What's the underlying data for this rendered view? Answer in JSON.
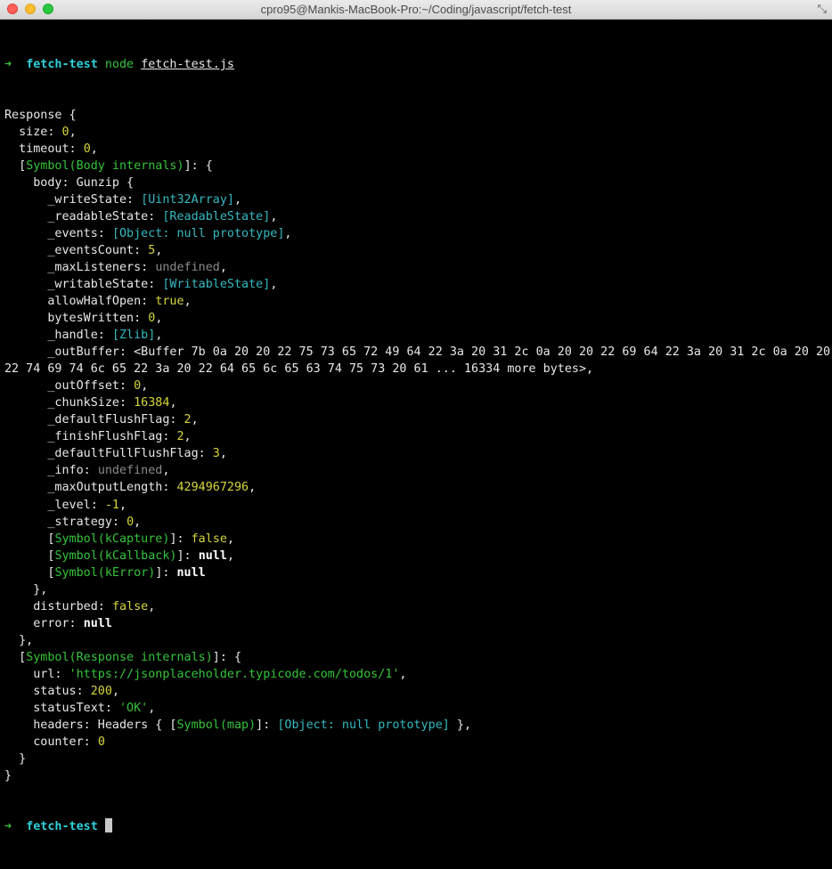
{
  "window": {
    "title": "cpro95@Mankis-MacBook-Pro:~/Coding/javascript/fetch-test",
    "fullscreen_glyph": "⤡"
  },
  "prompt": {
    "arrow": "➜",
    "dir": "fetch-test",
    "command": "node",
    "argument": "fetch-test.js"
  },
  "lines": [
    [
      {
        "t": "Response {"
      }
    ],
    [
      {
        "t": "  size: "
      },
      {
        "t": "0",
        "c": "num"
      },
      {
        "t": ","
      }
    ],
    [
      {
        "t": "  timeout: "
      },
      {
        "t": "0",
        "c": "num"
      },
      {
        "t": ","
      }
    ],
    [
      {
        "t": "  ["
      },
      {
        "t": "Symbol(Body internals)",
        "c": "sym"
      },
      {
        "t": "]: {"
      }
    ],
    [
      {
        "t": "    body: Gunzip {"
      }
    ],
    [
      {
        "t": "      _writeState: "
      },
      {
        "t": "[Uint32Array]",
        "c": "obj"
      },
      {
        "t": ","
      }
    ],
    [
      {
        "t": "      _readableState: "
      },
      {
        "t": "[ReadableState]",
        "c": "obj"
      },
      {
        "t": ","
      }
    ],
    [
      {
        "t": "      _events: "
      },
      {
        "t": "[Object: null prototype]",
        "c": "obj"
      },
      {
        "t": ","
      }
    ],
    [
      {
        "t": "      _eventsCount: "
      },
      {
        "t": "5",
        "c": "num"
      },
      {
        "t": ","
      }
    ],
    [
      {
        "t": "      _maxListeners: "
      },
      {
        "t": "undefined",
        "c": "undef"
      },
      {
        "t": ","
      }
    ],
    [
      {
        "t": "      _writableState: "
      },
      {
        "t": "[WritableState]",
        "c": "obj"
      },
      {
        "t": ","
      }
    ],
    [
      {
        "t": "      allowHalfOpen: "
      },
      {
        "t": "true",
        "c": "num"
      },
      {
        "t": ","
      }
    ],
    [
      {
        "t": "      bytesWritten: "
      },
      {
        "t": "0",
        "c": "num"
      },
      {
        "t": ","
      }
    ],
    [
      {
        "t": "      _handle: "
      },
      {
        "t": "[Zlib]",
        "c": "obj"
      },
      {
        "t": ","
      }
    ],
    [
      {
        "t": "      _outBuffer: <Buffer 7b 0a 20 20 22 75 73 65 72 49 64 22 3a 20 31 2c 0a 20 20 22 69 64 22 3a 20 31 2c 0a 20 20"
      }
    ],
    [
      {
        "t": "22 74 69 74 6c 65 22 3a 20 22 64 65 6c 65 63 74 75 73 20 61 ... 16334 more bytes>,"
      }
    ],
    [
      {
        "t": "      _outOffset: "
      },
      {
        "t": "0",
        "c": "num"
      },
      {
        "t": ","
      }
    ],
    [
      {
        "t": "      _chunkSize: "
      },
      {
        "t": "16384",
        "c": "num"
      },
      {
        "t": ","
      }
    ],
    [
      {
        "t": "      _defaultFlushFlag: "
      },
      {
        "t": "2",
        "c": "num"
      },
      {
        "t": ","
      }
    ],
    [
      {
        "t": "      _finishFlushFlag: "
      },
      {
        "t": "2",
        "c": "num"
      },
      {
        "t": ","
      }
    ],
    [
      {
        "t": "      _defaultFullFlushFlag: "
      },
      {
        "t": "3",
        "c": "num"
      },
      {
        "t": ","
      }
    ],
    [
      {
        "t": "      _info: "
      },
      {
        "t": "undefined",
        "c": "undef"
      },
      {
        "t": ","
      }
    ],
    [
      {
        "t": "      _maxOutputLength: "
      },
      {
        "t": "4294967296",
        "c": "num"
      },
      {
        "t": ","
      }
    ],
    [
      {
        "t": "      _level: "
      },
      {
        "t": "-1",
        "c": "num"
      },
      {
        "t": ","
      }
    ],
    [
      {
        "t": "      _strategy: "
      },
      {
        "t": "0",
        "c": "num"
      },
      {
        "t": ","
      }
    ],
    [
      {
        "t": "      ["
      },
      {
        "t": "Symbol(kCapture)",
        "c": "sym"
      },
      {
        "t": "]: "
      },
      {
        "t": "false",
        "c": "num"
      },
      {
        "t": ","
      }
    ],
    [
      {
        "t": "      ["
      },
      {
        "t": "Symbol(kCallback)",
        "c": "sym"
      },
      {
        "t": "]: "
      },
      {
        "t": "null",
        "c": "nul"
      },
      {
        "t": ","
      }
    ],
    [
      {
        "t": "      ["
      },
      {
        "t": "Symbol(kError)",
        "c": "sym"
      },
      {
        "t": "]: "
      },
      {
        "t": "null",
        "c": "nul"
      }
    ],
    [
      {
        "t": "    },"
      }
    ],
    [
      {
        "t": "    disturbed: "
      },
      {
        "t": "false",
        "c": "num"
      },
      {
        "t": ","
      }
    ],
    [
      {
        "t": "    error: "
      },
      {
        "t": "null",
        "c": "nul"
      }
    ],
    [
      {
        "t": "  },"
      }
    ],
    [
      {
        "t": "  ["
      },
      {
        "t": "Symbol(Response internals)",
        "c": "sym"
      },
      {
        "t": "]: {"
      }
    ],
    [
      {
        "t": "    url: "
      },
      {
        "t": "'https://jsonplaceholder.typicode.com/todos/1'",
        "c": "str"
      },
      {
        "t": ","
      }
    ],
    [
      {
        "t": "    status: "
      },
      {
        "t": "200",
        "c": "num"
      },
      {
        "t": ","
      }
    ],
    [
      {
        "t": "    statusText: "
      },
      {
        "t": "'OK'",
        "c": "str"
      },
      {
        "t": ","
      }
    ],
    [
      {
        "t": "    headers: Headers { ["
      },
      {
        "t": "Symbol(map)",
        "c": "sym"
      },
      {
        "t": "]: "
      },
      {
        "t": "[Object: null prototype]",
        "c": "obj"
      },
      {
        "t": " },"
      }
    ],
    [
      {
        "t": "    counter: "
      },
      {
        "t": "0",
        "c": "num"
      }
    ],
    [
      {
        "t": "  }"
      }
    ],
    [
      {
        "t": "}"
      }
    ]
  ],
  "colors": {
    "number": "#d6d63a",
    "string": "#35c43a",
    "symbol": "#35c43a",
    "object": "#35b9c2",
    "undefined": "#8a8a8a",
    "null": "#ffffff",
    "prompt_arrow": "#35c43a",
    "prompt_dir": "#2fd0d8"
  }
}
